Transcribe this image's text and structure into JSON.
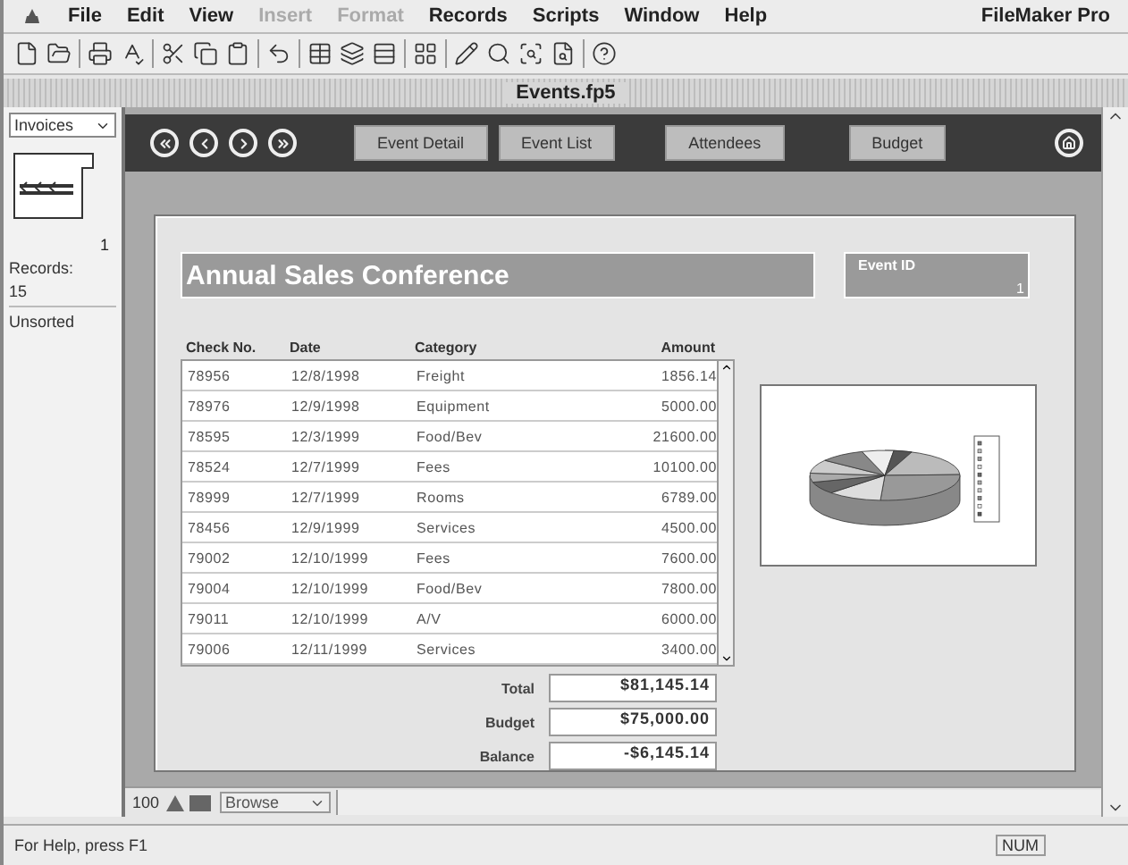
{
  "menu": [
    {
      "label": "File",
      "disabled": false
    },
    {
      "label": "Edit",
      "disabled": false
    },
    {
      "label": "View",
      "disabled": false
    },
    {
      "label": "Insert",
      "disabled": true
    },
    {
      "label": "Format",
      "disabled": true
    },
    {
      "label": "Records",
      "disabled": false
    },
    {
      "label": "Scripts",
      "disabled": false
    },
    {
      "label": "Window",
      "disabled": false
    },
    {
      "label": "Help",
      "disabled": false
    }
  ],
  "app_name": "FileMaker Pro",
  "window": {
    "title": "Events.fp5"
  },
  "status_area": {
    "layout_menu": "Invoices",
    "record_number": "1",
    "records_label": "Records:",
    "records_count": "15",
    "sort_state": "Unsorted"
  },
  "layout_buttons": [
    "Event Detail",
    "Event List",
    "Attendees",
    "Budget"
  ],
  "event": {
    "name": "Annual Sales Conference",
    "id_label": "Event ID",
    "id_value": "1"
  },
  "table": {
    "columns": [
      "Check No.",
      "Date",
      "Category",
      "Amount"
    ],
    "rows": [
      [
        "78956",
        "12/8/1998",
        "Freight",
        "1856.14"
      ],
      [
        "78976",
        "12/9/1998",
        "Equipment",
        "5000.00"
      ],
      [
        "78595",
        "12/3/1999",
        "Food/Bev",
        "21600.00"
      ],
      [
        "78524",
        "12/7/1999",
        "Fees",
        "10100.00"
      ],
      [
        "78999",
        "12/7/1999",
        "Rooms",
        "6789.00"
      ],
      [
        "78456",
        "12/9/1999",
        "Services",
        "4500.00"
      ],
      [
        "79002",
        "12/10/1999",
        "Fees",
        "7600.00"
      ],
      [
        "79004",
        "12/10/1999",
        "Food/Bev",
        "7800.00"
      ],
      [
        "79011",
        "12/10/1999",
        "A/V",
        "6000.00"
      ],
      [
        "79006",
        "12/11/1999",
        "Services",
        "3400.00"
      ]
    ]
  },
  "totals": [
    {
      "label": "Total",
      "value": "$81,145.14"
    },
    {
      "label": "Budget",
      "value": "$75,000.00"
    },
    {
      "label": "Balance",
      "value": "-$6,145.14"
    }
  ],
  "bottom_bar": {
    "zoom": "100",
    "mode": "Browse"
  },
  "status_bar": {
    "help": "For Help, press F1",
    "num": "NUM"
  }
}
